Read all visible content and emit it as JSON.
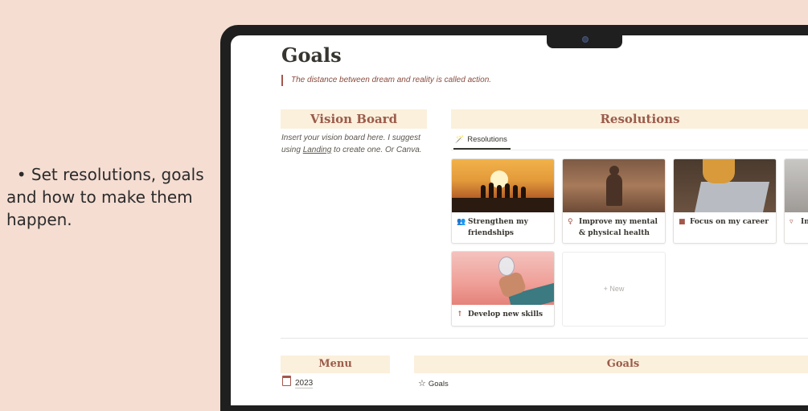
{
  "caption": {
    "bullet": "•",
    "text": "Set resolutions, goals and how to make them happen."
  },
  "page": {
    "title": "Goals",
    "quote": "The distance between dream and reality is called action."
  },
  "vision_board": {
    "header": "Vision Board",
    "text_before": "Insert your vision board here. I suggest using ",
    "link": "Landing",
    "text_after": " to create one. Or Canva."
  },
  "resolutions": {
    "header": "Resolutions",
    "tab_label": "Resolutions",
    "cards": [
      {
        "label": "Strengthen my friendships",
        "icon": "people-icon"
      },
      {
        "label": "Improve my mental & physical health",
        "icon": "mind-icon"
      },
      {
        "label": "Focus on my career",
        "icon": "briefcase-icon"
      },
      {
        "label": "In",
        "icon": "basket-icon"
      },
      {
        "label": "Develop new skills",
        "icon": "arrow-up-icon"
      }
    ],
    "new_label": "+ New"
  },
  "menu": {
    "header": "Menu",
    "items": [
      {
        "label": "2023",
        "icon": "calendar-icon"
      }
    ]
  },
  "goals_section": {
    "header": "Goals",
    "view_label": "Goals"
  },
  "colors": {
    "background": "#f5ddd2",
    "header_fill": "#fbf0dc",
    "accent": "#a4574b"
  }
}
